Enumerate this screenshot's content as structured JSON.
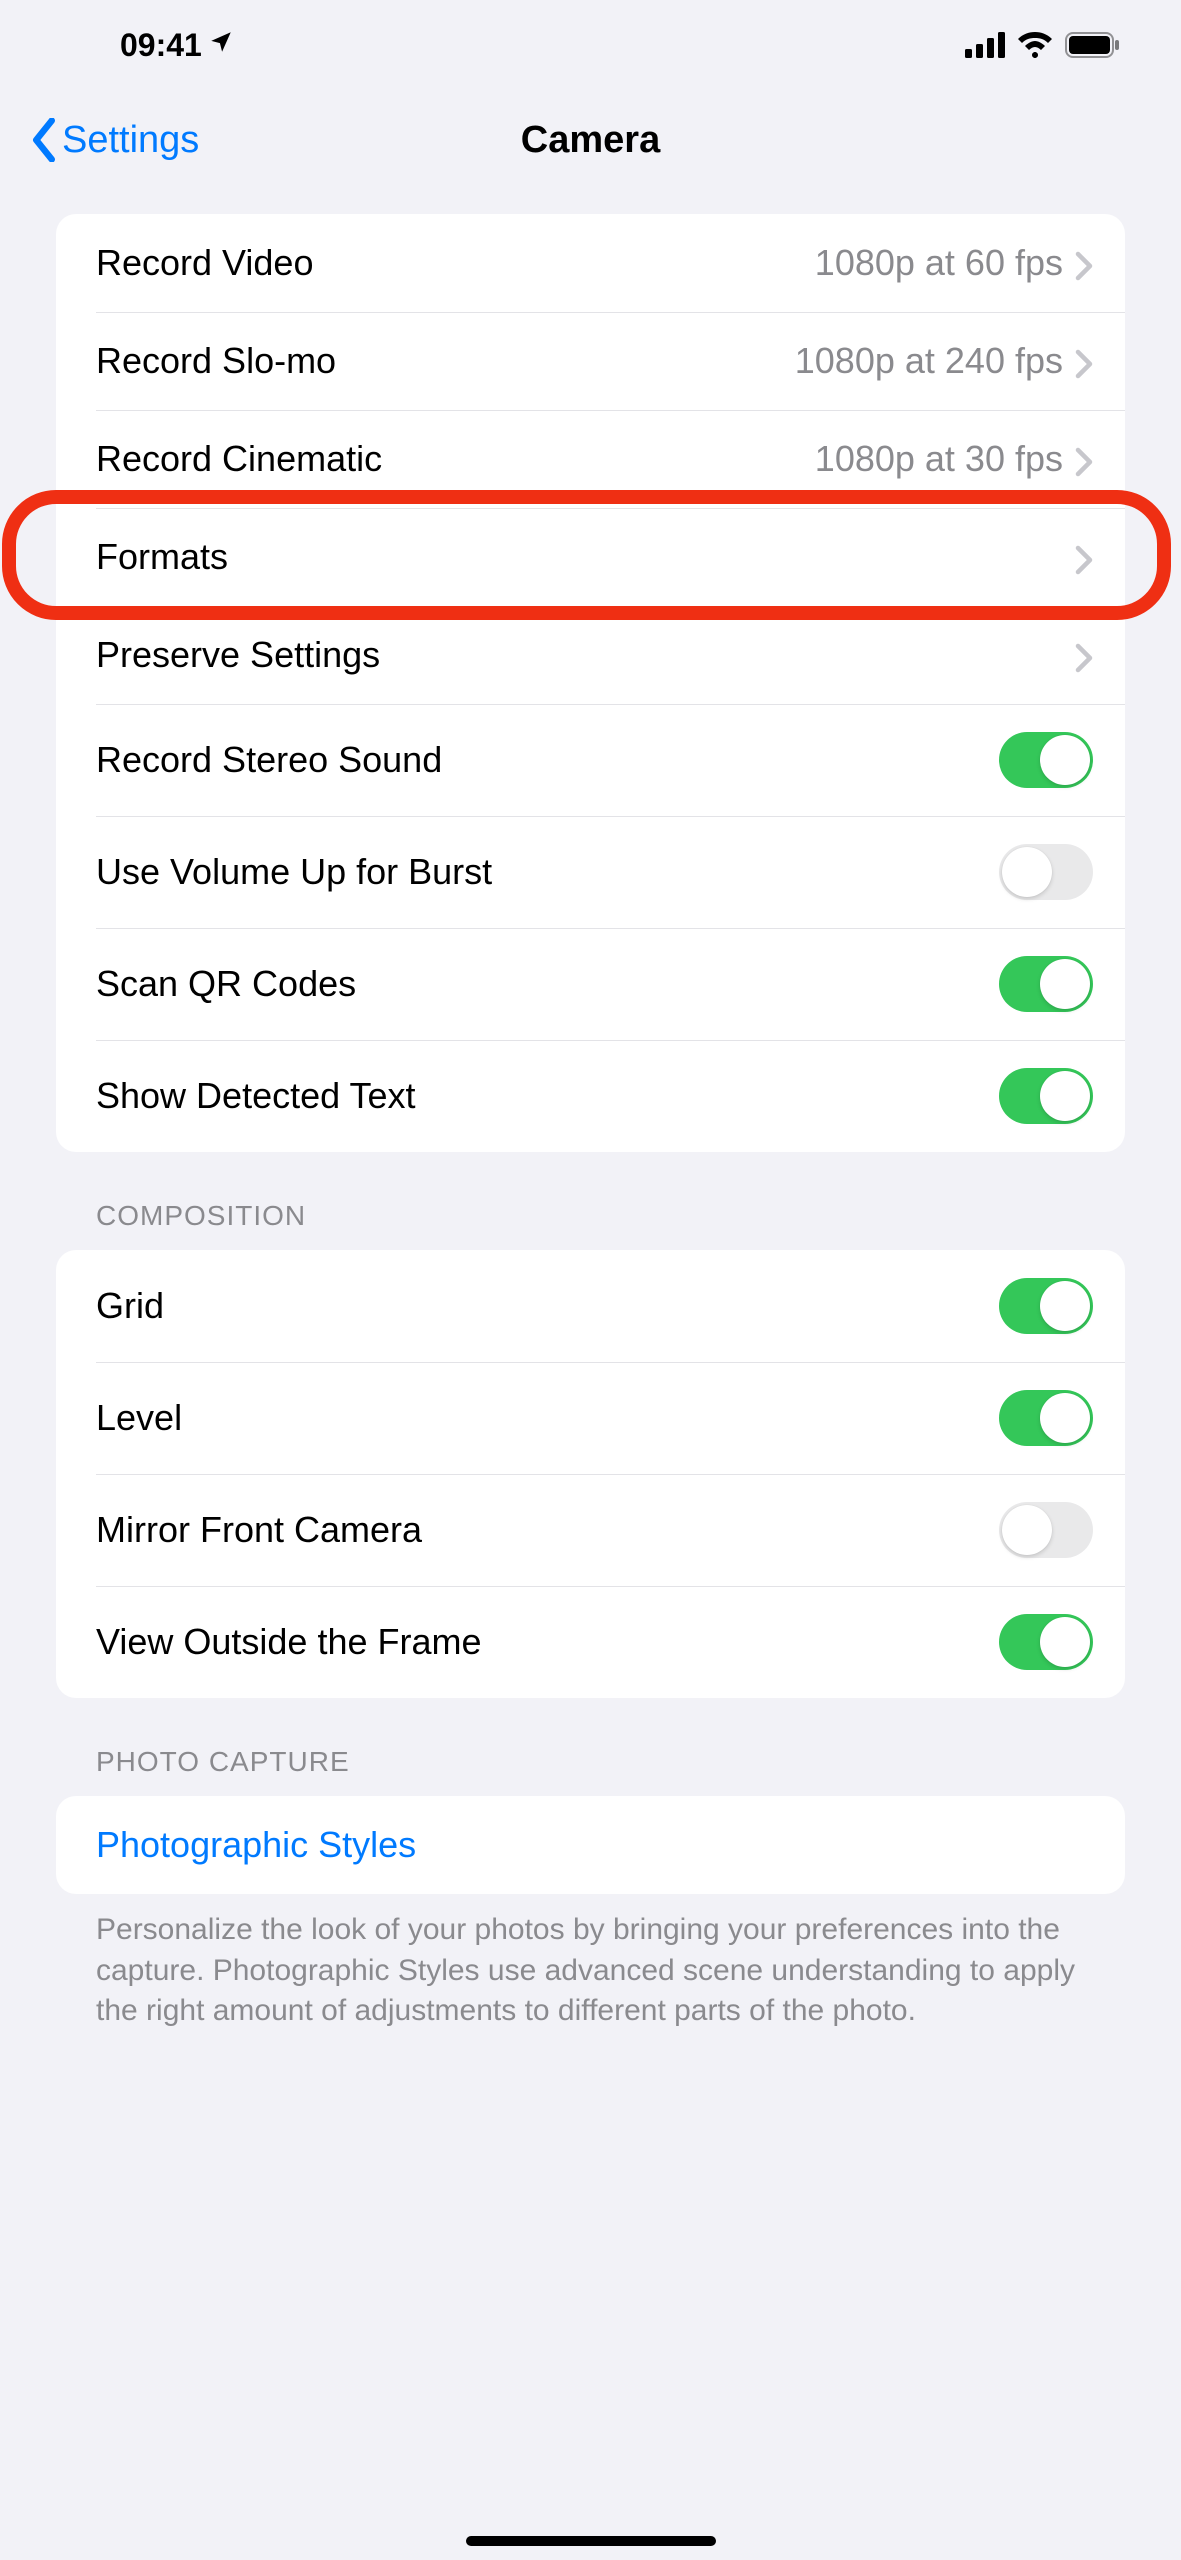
{
  "status": {
    "time": "09:41"
  },
  "nav": {
    "back": "Settings",
    "title": "Camera"
  },
  "sections": {
    "video": [
      {
        "label": "Record Video",
        "detail": "1080p at 60 fps"
      },
      {
        "label": "Record Slo-mo",
        "detail": "1080p at 240 fps"
      },
      {
        "label": "Record Cinematic",
        "detail": "1080p at 30 fps"
      },
      {
        "label": "Formats"
      },
      {
        "label": "Preserve Settings"
      },
      {
        "label": "Record Stereo Sound",
        "toggle": true
      },
      {
        "label": "Use Volume Up for Burst",
        "toggle": false
      },
      {
        "label": "Scan QR Codes",
        "toggle": true
      },
      {
        "label": "Show Detected Text",
        "toggle": true
      }
    ],
    "composition": {
      "header": "COMPOSITION",
      "rows": [
        {
          "label": "Grid",
          "toggle": true
        },
        {
          "label": "Level",
          "toggle": true
        },
        {
          "label": "Mirror Front Camera",
          "toggle": false
        },
        {
          "label": "View Outside the Frame",
          "toggle": true
        }
      ]
    },
    "photo_capture": {
      "header": "PHOTO CAPTURE",
      "rows": [
        {
          "label": "Photographic Styles"
        }
      ],
      "footer": "Personalize the look of your photos by bringing your preferences into the capture. Photographic Styles use advanced scene understanding to apply the right amount of adjustments to different parts of the photo."
    }
  }
}
